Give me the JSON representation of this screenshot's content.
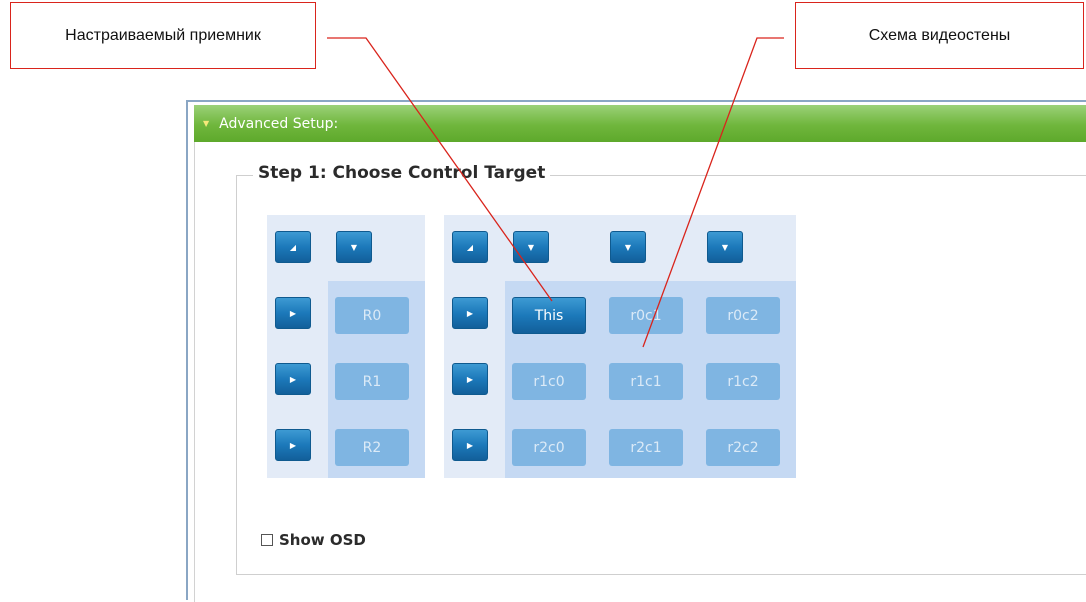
{
  "callouts": {
    "left": "Настраиваемый приемник",
    "right": "Схема видеостены"
  },
  "panel": {
    "title": "Advanced Setup:",
    "step_title": "Step 1: Choose Control Target"
  },
  "row_labels": [
    "R0",
    "R1",
    "R2"
  ],
  "grid": [
    [
      "This",
      "r0c1",
      "r0c2"
    ],
    [
      "r1c0",
      "r1c1",
      "r1c2"
    ],
    [
      "r2c0",
      "r2c1",
      "r2c2"
    ]
  ],
  "selected_cell": "This",
  "checkbox": {
    "label": "Show OSD",
    "checked": false
  },
  "icons": {
    "expand_caret": "caret-down-icon",
    "column_select": "caret-down-icon",
    "row_select": "caret-right-icon",
    "select_all": "corner-triangle-icon"
  },
  "colors": {
    "callout_border": "#d9241c",
    "header_green": "#6fb63c",
    "button_blue": "#1c79ba",
    "cell_blue": "#7fb5e2",
    "grid_zone": "#c5d9f3",
    "header_zone": "#e3ebf7"
  }
}
